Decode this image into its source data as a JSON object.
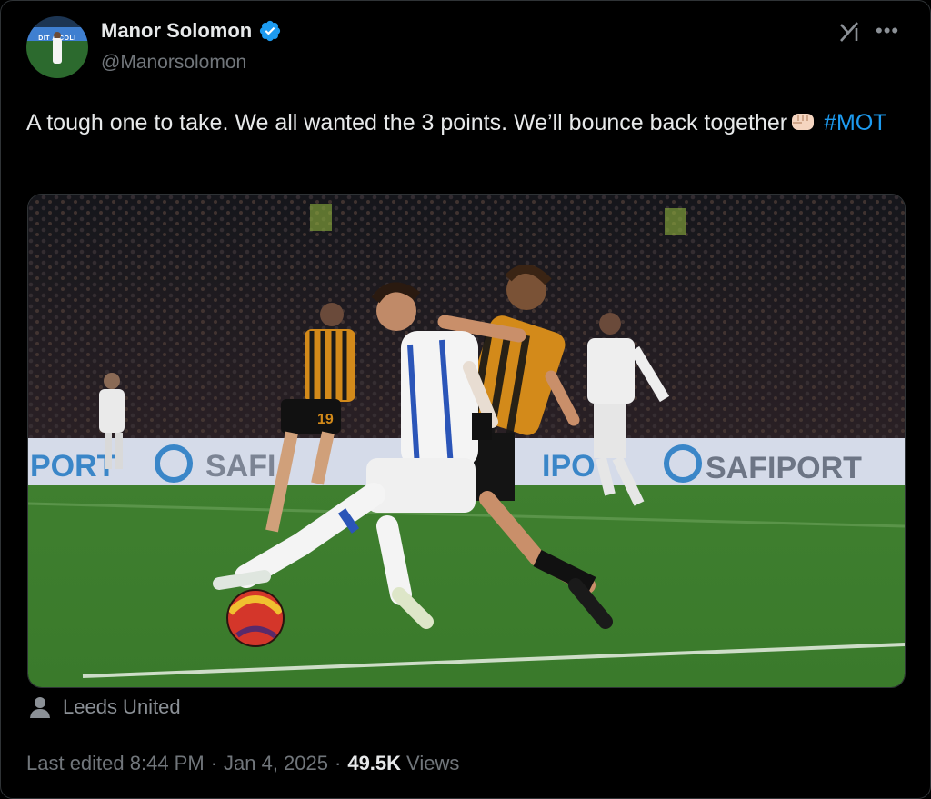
{
  "author": {
    "display_name": "Manor Solomon",
    "handle": "@Manorsolomon",
    "avatar_banner": "DIT A  COLI",
    "verified_color": "#1d9bf0"
  },
  "tweet": {
    "text": "A tough one to take. We all wanted the 3 points. We’ll bounce back together",
    "emoji": "fist-bump",
    "hashtag": "#MOT"
  },
  "media": {
    "ad_board_left": "PORT",
    "ad_board_mid": "SAFI",
    "ad_board_right": "SAFIPORT",
    "ad_board_center": "IPO",
    "player_number": "19"
  },
  "location": {
    "label": "Leeds United"
  },
  "meta": {
    "edited_label": "Last edited 8:44 PM",
    "separator": "·",
    "date": "Jan 4, 2025",
    "views_count": "49.5K",
    "views_label": "Views"
  },
  "colors": {
    "background": "#000000",
    "text": "#e7e9ea",
    "secondary_text": "#71767b",
    "link": "#1d9bf0"
  },
  "icons": {
    "grok": "grok-icon",
    "more": "more-icon",
    "location": "person-icon"
  }
}
